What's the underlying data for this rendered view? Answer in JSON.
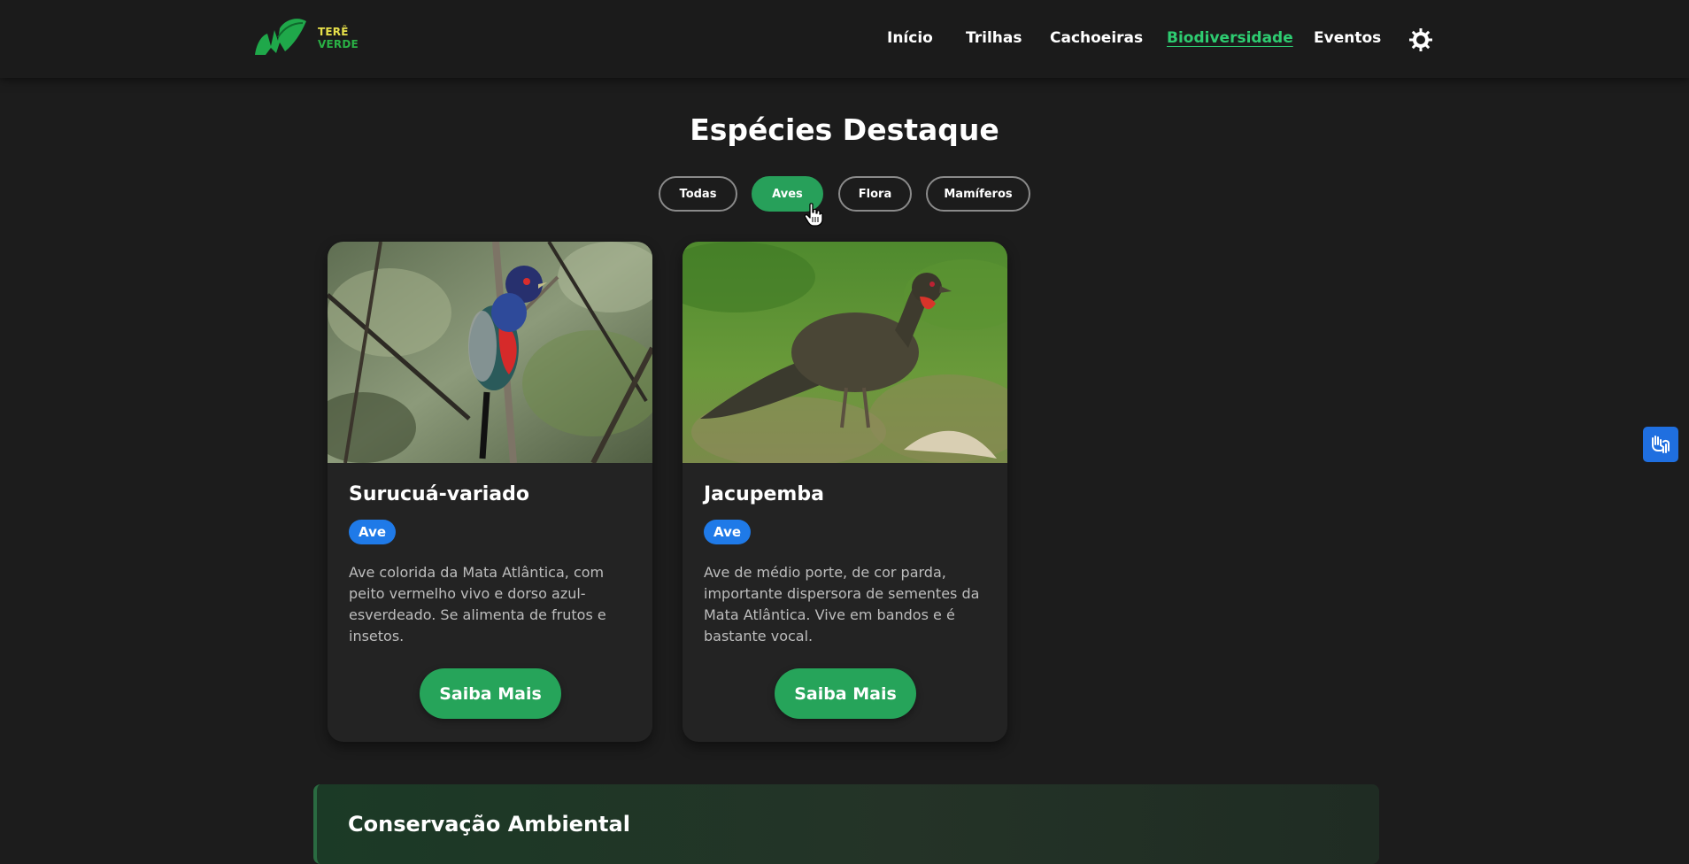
{
  "header": {
    "logo": {
      "line1": "TERÊ",
      "line2": "VERDE"
    },
    "nav": [
      {
        "label": "Início",
        "active": false
      },
      {
        "label": "Trilhas",
        "active": false
      },
      {
        "label": "Cachoeiras",
        "active": false
      },
      {
        "label": "Biodiversidade",
        "active": true
      },
      {
        "label": "Eventos",
        "active": false
      }
    ],
    "theme_toggle_icon": "sun-icon"
  },
  "section": {
    "title": "Espécies Destaque",
    "filters": [
      {
        "label": "Todas",
        "active": false
      },
      {
        "label": "Aves",
        "active": true
      },
      {
        "label": "Flora",
        "active": false
      },
      {
        "label": "Mamíferos",
        "active": false
      }
    ]
  },
  "cards": [
    {
      "title": "Surucuá-variado",
      "badge": "Ave",
      "description": "Ave colorida da Mata Atlântica, com peito vermelho vivo e dorso azul-esverdeado. Se alimenta de frutos e insetos.",
      "button": "Saiba Mais",
      "image": "trogon-bird-photo"
    },
    {
      "title": "Jacupemba",
      "badge": "Ave",
      "description": "Ave de médio porte, de cor parda, importante dispersora de sementes da Mata Atlântica. Vive em bandos e é bastante vocal.",
      "button": "Saiba Mais",
      "image": "guan-bird-photo"
    }
  ],
  "conservation": {
    "title": "Conservação Ambiental"
  },
  "accessibility_button": {
    "icon": "sign-language-hands-icon"
  },
  "colors": {
    "background": "#1c1c1c",
    "accent_green": "#27a05a",
    "active_nav": "#2ecc71",
    "badge_blue": "#1f7ae8"
  }
}
